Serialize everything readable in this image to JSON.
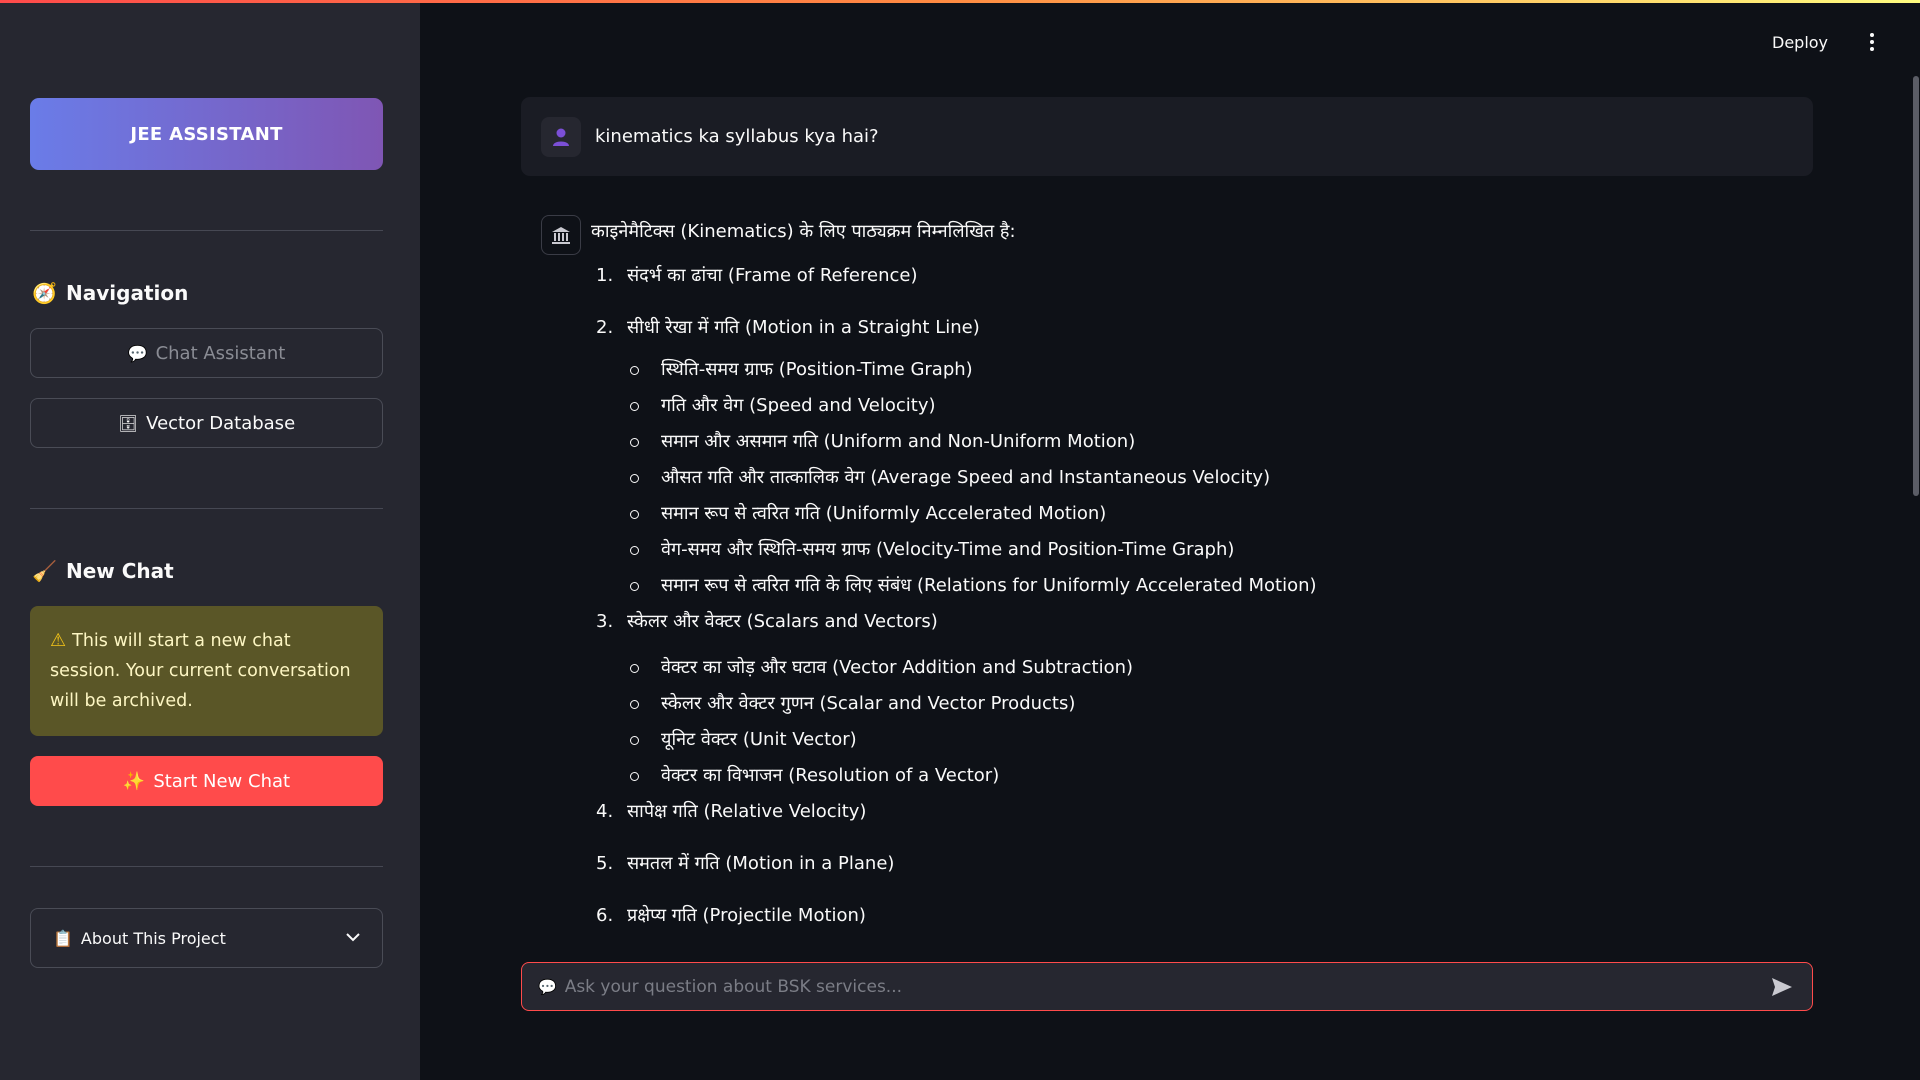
{
  "header": {
    "deploy_label": "Deploy",
    "menu_icon": "kebab-menu-icon"
  },
  "sidebar": {
    "hero_label": "JEE ASSISTANT",
    "navigation": {
      "title": "Navigation",
      "icon": "compass-icon",
      "chat_assistant_label": "Chat Assistant",
      "vector_database_label": "Vector Database"
    },
    "new_chat": {
      "title": "New Chat",
      "icon": "broom-icon",
      "warning_text": "This will start a new chat session. Your current conversation will be archived.",
      "start_label": "Start New Chat"
    },
    "about_label": "About This Project"
  },
  "chat": {
    "user_message": "kinematics ka syllabus kya hai?",
    "bot_intro": "काइनेमैटिक्स (Kinematics) के लिए पाठ्यक्रम निम्नलिखित है:",
    "items": [
      {
        "num": "1.",
        "text": "संदर्भ का ढांचा (Frame of Reference)"
      },
      {
        "num": "2.",
        "text": "सीधी रेखा में गति (Motion in a Straight Line)"
      },
      {
        "num": "3.",
        "text": "स्केलर और वेक्टर (Scalars and Vectors)"
      },
      {
        "num": "4.",
        "text": "सापेक्ष गति (Relative Velocity)"
      },
      {
        "num": "5.",
        "text": "समतल में गति (Motion in a Plane)"
      },
      {
        "num": "6.",
        "text": "प्रक्षेप्य गति (Projectile Motion)"
      }
    ],
    "sub_items_2": [
      "स्थिति-समय ग्राफ (Position-Time Graph)",
      "गति और वेग (Speed and Velocity)",
      "समान और असमान गति (Uniform and Non-Uniform Motion)",
      "औसत गति और तात्कालिक वेग (Average Speed and Instantaneous Velocity)",
      "समान रूप से त्वरित गति (Uniformly Accelerated Motion)",
      "वेग-समय और स्थिति-समय ग्राफ (Velocity-Time and Position-Time Graph)",
      "समान रूप से त्वरित गति के लिए संबंध (Relations for Uniformly Accelerated Motion)"
    ],
    "sub_items_3": [
      "वेक्टर का जोड़ और घटाव (Vector Addition and Subtraction)",
      "स्केलर और वेक्टर गुणन (Scalar and Vector Products)",
      "यूनिट वेक्टर (Unit Vector)",
      "वेक्टर का विभाजन (Resolution of a Vector)"
    ]
  },
  "input": {
    "placeholder": "Ask your question about BSK services..."
  },
  "colors": {
    "accent": "#ff4b4b",
    "hero_start": "#6a7ce8",
    "hero_end": "#7f56b4",
    "warning_bg": "#5a5627"
  }
}
